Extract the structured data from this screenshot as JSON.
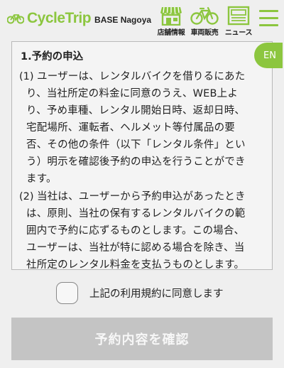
{
  "header": {
    "logo_text": "CycleTrip",
    "logo_sub": "BASE Nagoya",
    "nav": [
      {
        "label": "店舗情報",
        "icon": "store-icon"
      },
      {
        "label": "車両販売",
        "icon": "bicycle-icon"
      },
      {
        "label": "ニュース",
        "icon": "news-icon"
      }
    ],
    "menu_icon": "hamburger-menu-icon"
  },
  "language_toggle": {
    "label": "EN"
  },
  "terms": {
    "heading": "1.予約の申込",
    "items": [
      {
        "number": "(1)",
        "lines": [
          "ユーザーは、レンタルバイクを借りるにあた",
          "り、当社所定の料金に同意のうえ、WEB上よ",
          "り、予め車種、レンタル開始日時、返却日時、",
          "宅配場所、運転者、ヘルメット等付属品の要",
          "否、その他の条件（以下「レンタル条件」とい",
          "う）明示を確認後予約の申込を行うことができ",
          "ます。"
        ]
      },
      {
        "number": "(2)",
        "lines": [
          "当社は、ユーザーから予約申込があったとき",
          "は、原則、当社の保有するレンタルバイクの範",
          "囲内で予約に応ずるものとします。この場合、",
          "ユーザーは、当社が特に認める場合を除き、当",
          "社所定のレンタル料金を支払うものとします。"
        ]
      }
    ]
  },
  "agreement": {
    "label": "上記の利用規約に同意します",
    "checked": false
  },
  "confirm_button": {
    "label": "予約内容を確認",
    "enabled": false
  },
  "colors": {
    "brand_green": "#8cc63f",
    "disabled_button": "#c4c4c4",
    "background": "#efefef"
  }
}
